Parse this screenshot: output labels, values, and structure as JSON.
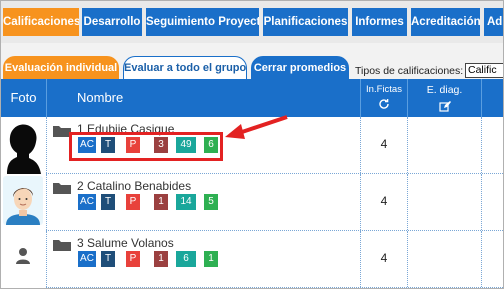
{
  "top_tabs": [
    {
      "label": "Calificaciones",
      "active": true
    },
    {
      "label": "Desarrollo",
      "active": false
    },
    {
      "label": "Seguimiento Proyecto",
      "active": false
    },
    {
      "label": "Planificaciones",
      "active": false
    },
    {
      "label": "Informes",
      "active": false
    },
    {
      "label": "Acreditación",
      "active": false
    },
    {
      "label": "Ad.",
      "active": false
    }
  ],
  "sub_tabs": [
    {
      "label": "Evaluación individual",
      "state": "active"
    },
    {
      "label": "Evaluar a todo el grupo",
      "state": "inactive"
    },
    {
      "label": "Cerrar promedios",
      "state": "blue"
    }
  ],
  "types_label": "Tipos de calificaciones:",
  "types_select_value": "Calific",
  "columns": {
    "foto": "Foto",
    "nombre": "Nombre",
    "fictas_line1": "In.Fictas",
    "ediag_line1": "E. diag."
  },
  "students": [
    {
      "name": "1 Edubiie Casique",
      "badges": [
        "AC",
        "T",
        "P",
        "3",
        "49",
        "6"
      ],
      "fictas": "4"
    },
    {
      "name": "2 Catalino Benabides",
      "badges": [
        "AC",
        "T",
        "P",
        "1",
        "14",
        "5"
      ],
      "fictas": "4"
    },
    {
      "name": "3 Salume Volanos",
      "badges": [
        "AC",
        "T",
        "P",
        "1",
        "6",
        "1"
      ],
      "fictas": "4"
    }
  ],
  "colors": {
    "primary_blue": "#1a6fc9",
    "active_orange": "#f7931e",
    "highlight_red": "#e32222",
    "badge_blue": "#1a6fc9",
    "badge_navy": "#1f4e79",
    "badge_red": "#e8413b",
    "badge_brown": "#9b4040",
    "badge_teal": "#1aa79b",
    "badge_green": "#2eb052"
  }
}
